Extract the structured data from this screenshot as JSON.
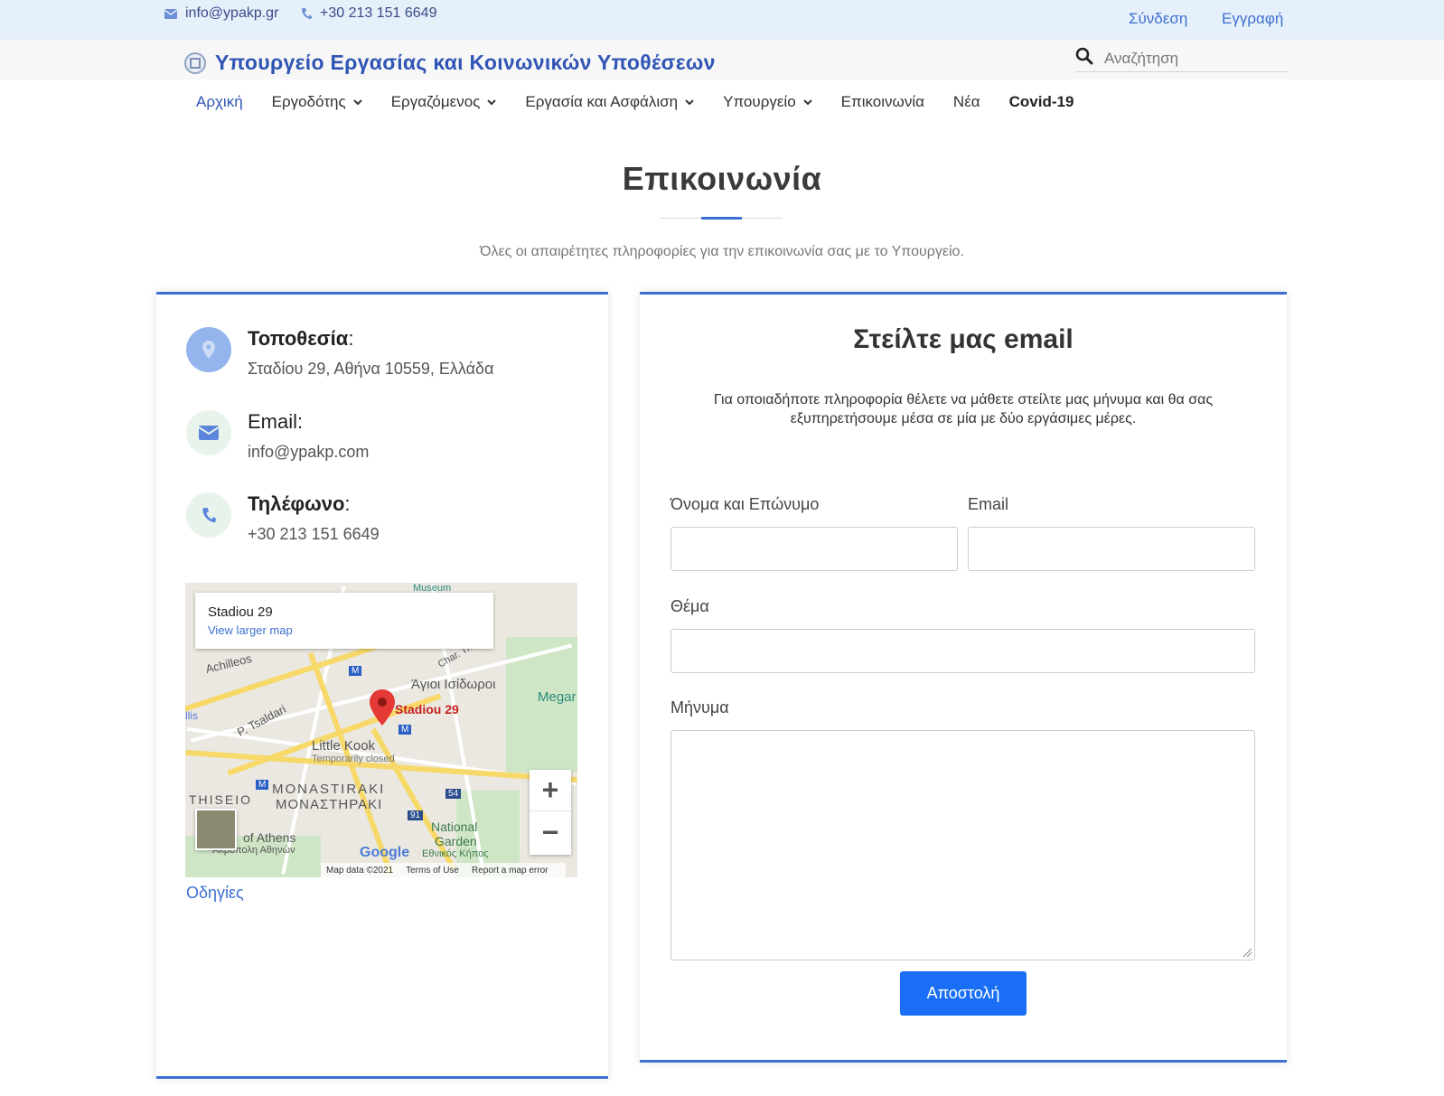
{
  "topbar": {
    "email": "info@ypakp.gr",
    "phone": "+30 213 151 6649",
    "login": "Σύνδεση",
    "register": "Εγγραφή",
    "icons": [
      "envelope-icon",
      "phone-icon"
    ]
  },
  "brand": {
    "name": "Υπουργείο Εργασίας και Κοινωνικών Υποθέσεων"
  },
  "search": {
    "placeholder": "Αναζήτηση"
  },
  "nav": {
    "items": [
      {
        "label": "Αρχική",
        "active": true,
        "dropdown": false
      },
      {
        "label": "Εργοδότης",
        "dropdown": true
      },
      {
        "label": "Εργαζόμενος",
        "dropdown": true
      },
      {
        "label": "Εργασία και Ασφάλιση",
        "dropdown": true
      },
      {
        "label": "Υπουργείο",
        "dropdown": true
      },
      {
        "label": "Επικοινωνία",
        "dropdown": false
      },
      {
        "label": "Νέα",
        "dropdown": false
      },
      {
        "label": "Covid-19",
        "dropdown": false,
        "bold": true
      }
    ]
  },
  "page": {
    "title": "Επικοινωνία",
    "subtitle": "Όλες οι απαιρέτητες πληροφορίες για την επικοινωνία σας με το Υπουργείο."
  },
  "contact": {
    "location_label": "Τοποθεσία",
    "location_value": "Σταδίου 29, Αθήνα 10559, Ελλάδα",
    "email_label": "Email",
    "email_value": "info@ypakp.com",
    "phone_label": "Τηλέφωνο",
    "phone_value": "+30 213 151 6649",
    "colon": ":"
  },
  "map": {
    "place": "Stadiou 29",
    "larger_map": "View larger map",
    "pin_label": "Stadiou 29",
    "labels": {
      "achilleos": "Achilleos",
      "tsaldari": "P. Tsaldari",
      "agioi": "Άγιοι Ισίδωροι",
      "megar": "Megar",
      "little_kook": "Little Kook",
      "temp_closed": "Temporarily closed",
      "monastiraki_en": "MONASTIRAKI",
      "monastiraki_gr": "ΜΟΝΑΣΤΗΡΑΚΙ",
      "thiseio": "THISEIO",
      "national_garden": "National",
      "national_garden2": "Garden",
      "ethnikos": "Εθνικός Κήπος",
      "athens": "of Athens",
      "akropoli": "Ακρόπολη Αθηνών",
      "char_tri": "Char. Tri",
      "museum": "Museum",
      "ellis": "llis",
      "route54": "54",
      "route91": "91",
      "metro": "M"
    },
    "google": "Google",
    "map_data": "Map data ©2021",
    "terms": "Terms of Use",
    "report": "Report a map error",
    "zoom_in": "+",
    "zoom_out": "−",
    "directions": "Οδηγίες"
  },
  "form": {
    "title": "Στείλτε μας email",
    "description": "Για οποιαδήποτε πληροφορία θέλετε να μάθετε στείλτε μας μήνυμα και θα σας εξυπηρετήσουμε μέσα σε μία με δύο εργάσιμες μέρες.",
    "name_label": "Όνομα και Επώνυμο",
    "email_label": "Email",
    "subject_label": "Θέμα",
    "message_label": "Μήνυμα",
    "name_value": "",
    "email_value": "",
    "subject_value": "",
    "message_value": "",
    "submit": "Αποστολή"
  },
  "colors": {
    "accent": "#3d6fd1",
    "button": "#1a6ef5",
    "topbar_bg": "#e6f0fa"
  }
}
